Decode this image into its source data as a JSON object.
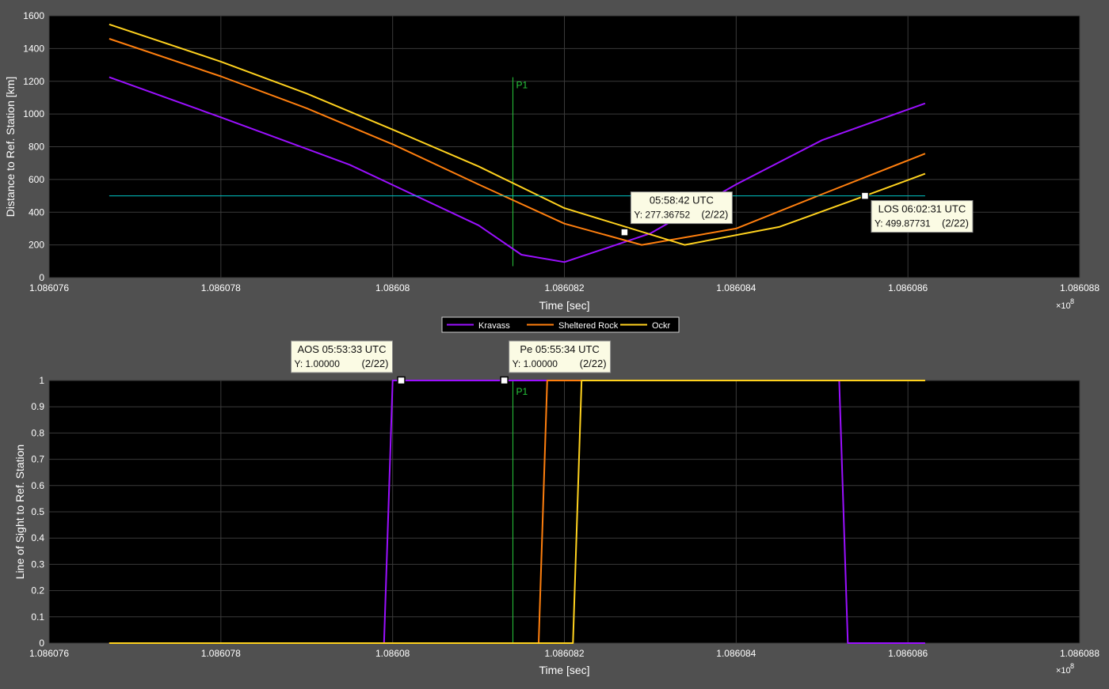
{
  "figure": {
    "background": "#505050",
    "axes_background": "#000000",
    "grid_color": "#3a3a3a",
    "text_color": "#ffffff",
    "x_exponent_base": "×10",
    "x_exponent_power": "8"
  },
  "legend": {
    "entries": [
      {
        "name": "Kravass",
        "color": "#9b10ff"
      },
      {
        "name": "Sheltered Rock",
        "color": "#ff7f0e"
      },
      {
        "name": "Ockr",
        "color": "#ffd21e"
      }
    ]
  },
  "chart_data": [
    {
      "type": "line",
      "xlabel": "Time [sec]",
      "ylabel": "Distance to Ref. Station [km]",
      "xlim": [
        1.086076,
        1.086088
      ],
      "ylim": [
        0,
        1600
      ],
      "xticks": [
        1.086076,
        1.086078,
        1.08608,
        1.086082,
        1.086084,
        1.086086,
        1.086088
      ],
      "xtick_labels": [
        "1.086076",
        "1.086078",
        "1.08608",
        "1.086082",
        "1.086084",
        "1.086086",
        "1.086088"
      ],
      "yticks": [
        0,
        200,
        400,
        600,
        800,
        1000,
        1200,
        1400,
        1600
      ],
      "ytick_labels": [
        "0",
        "200",
        "400",
        "600",
        "800",
        "1000",
        "1200",
        "1400",
        "1600"
      ],
      "grid": true,
      "series": [
        {
          "name": "Kravass",
          "color": "#9b10ff",
          "x": [
            1.0860767,
            1.086078,
            1.0860795,
            1.086081,
            1.0860815,
            1.086082,
            1.086083,
            1.086084,
            1.086085,
            1.0860862
          ],
          "y": [
            1225,
            980,
            690,
            320,
            140,
            95,
            270,
            570,
            840,
            1065
          ]
        },
        {
          "name": "Sheltered Rock",
          "color": "#ff7f0e",
          "x": [
            1.0860767,
            1.086078,
            1.086079,
            1.08608,
            1.086081,
            1.086082,
            1.0860829,
            1.086084,
            1.086085,
            1.0860862
          ],
          "y": [
            1460,
            1230,
            1035,
            815,
            570,
            330,
            200,
            300,
            510,
            758
          ]
        },
        {
          "name": "Ockr",
          "color": "#ffd21e",
          "x": [
            1.0860767,
            1.086078,
            1.086079,
            1.08608,
            1.086081,
            1.086082,
            1.0860834,
            1.0860845,
            1.0860855,
            1.0860862
          ],
          "y": [
            1548,
            1320,
            1125,
            905,
            680,
            425,
            200,
            310,
            500,
            635
          ]
        },
        {
          "name": "",
          "color": "#00c8c8",
          "x": [
            1.0860767,
            1.0860862
          ],
          "y": [
            500,
            500
          ]
        }
      ],
      "vline": {
        "x": 1.0860814,
        "y_range": [
          70,
          1225
        ],
        "label": "P1",
        "color": "#27c83c"
      },
      "datatips": [
        {
          "x": 1.0860827,
          "y": 277.36752,
          "title": "05:58:42 UTC",
          "value": "Y: 277.36752",
          "date": "(2/22)",
          "side": "above"
        },
        {
          "x": 1.0860855,
          "y": 499.87731,
          "title": "LOS 06:02:31 UTC",
          "value": "Y: 499.87731",
          "date": "(2/22)",
          "side": "below"
        }
      ]
    },
    {
      "type": "line",
      "xlabel": "Time [sec]",
      "ylabel": "Line of Sight to Ref. Station",
      "xlim": [
        1.086076,
        1.086088
      ],
      "ylim": [
        0,
        1
      ],
      "xticks": [
        1.086076,
        1.086078,
        1.08608,
        1.086082,
        1.086084,
        1.086086,
        1.086088
      ],
      "xtick_labels": [
        "1.086076",
        "1.086078",
        "1.08608",
        "1.086082",
        "1.086084",
        "1.086086",
        "1.086088"
      ],
      "yticks": [
        0,
        0.1,
        0.2,
        0.3,
        0.4,
        0.5,
        0.6,
        0.7,
        0.8,
        0.9,
        1
      ],
      "ytick_labels": [
        "0",
        "0.1",
        "0.2",
        "0.3",
        "0.4",
        "0.5",
        "0.6",
        "0.7",
        "0.8",
        "0.9",
        "1"
      ],
      "grid": true,
      "series": [
        {
          "name": "Kravass",
          "color": "#9b10ff",
          "x": [
            1.0860767,
            1.0860799,
            1.08608,
            1.0860852,
            1.0860853,
            1.0860862
          ],
          "y": [
            0,
            0,
            1,
            1,
            0,
            0
          ]
        },
        {
          "name": "Sheltered Rock",
          "color": "#ff7f0e",
          "x": [
            1.0860767,
            1.0860817,
            1.0860818,
            1.0860862
          ],
          "y": [
            0,
            0,
            1,
            1
          ]
        },
        {
          "name": "Ockr",
          "color": "#ffd21e",
          "x": [
            1.0860767,
            1.0860821,
            1.0860822,
            1.0860862
          ],
          "y": [
            0,
            0,
            1,
            1
          ]
        }
      ],
      "vline": {
        "x": 1.0860814,
        "y_range": [
          0,
          1
        ],
        "label": "P1",
        "color": "#27c83c"
      },
      "datatips": [
        {
          "x": 1.0860801,
          "y": 1.0,
          "title": "AOS 05:53:33 UTC",
          "value": "Y: 1.00000",
          "date": "(2/22)",
          "side": "above"
        },
        {
          "x": 1.0860813,
          "y": 1.0,
          "title": "Pe 05:55:34 UTC",
          "value": "Y: 1.00000",
          "date": "(2/22)",
          "side": "above"
        }
      ]
    }
  ]
}
